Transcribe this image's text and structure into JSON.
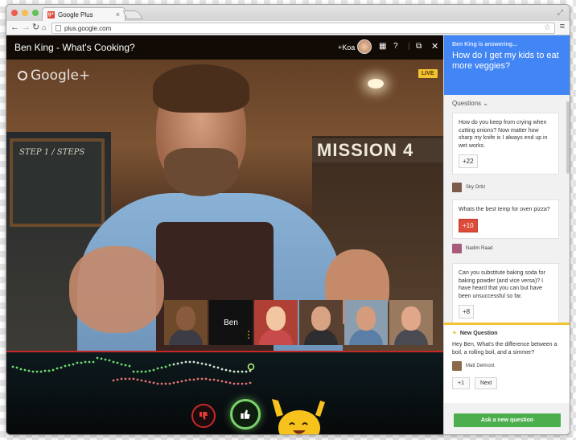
{
  "browser": {
    "tab_title": "Google Plus",
    "favicon_text": "g+",
    "url": "plus.google.com",
    "traffic_lights": [
      "#ee5c54",
      "#f5be4f",
      "#5fc453"
    ]
  },
  "hangout": {
    "title": "Ben King - What's Cooking?",
    "invite_label": "+Koa",
    "logo_text": "Google+",
    "live_badge": "LIVE",
    "sign_text": "MISSION 4",
    "chalkboard_text": "STEP 1 / STEPS",
    "participants": [
      {
        "face": "#8a5a3c",
        "body": "#3c3c46",
        "bg": "#6e4a2a",
        "label": ""
      },
      {
        "face": "",
        "body": "",
        "bg": "#111111",
        "label": "Ben"
      },
      {
        "face": "#f3c6a2",
        "body": "#c94a4a",
        "bg": "#b04036",
        "label": ""
      },
      {
        "face": "#d8a382",
        "body": "#2e2e30",
        "bg": "#5a4030",
        "label": ""
      },
      {
        "face": "#d49c7c",
        "body": "#5b7ea6",
        "bg": "#8a9eb0",
        "label": ""
      },
      {
        "face": "#e0a78a",
        "body": "#4a4a52",
        "bg": "#9a7a5e",
        "label": ""
      }
    ]
  },
  "side_panel": {
    "answering_label": "Ben King is answering...",
    "current_question": "How do I get my kids to eat more veggies?",
    "questions_toggle": "Questions",
    "questions": [
      {
        "text": "How do you keep from crying when cutting onions? Now matter how sharp my knife is I always end up in wet works.",
        "votes": "+22",
        "hot": false,
        "author": "Sky Ortiz"
      },
      {
        "text": "Whats the best temp for oven pizza?",
        "votes": "+10",
        "hot": true,
        "author": "Nadim Raad"
      },
      {
        "text": "Can you substitute baking soda for baking powder (and vice versa)? I have heard that you can but have been unsuccessful so far.",
        "votes": "+8",
        "hot": false,
        "author": ""
      }
    ],
    "new_question": {
      "heading": "New Question",
      "text": "Hey Ben, What's the difference between a boil, a rolling boil, and a simmer?",
      "author": "Matt Delmont",
      "plus_one": "+1",
      "next": "Next"
    },
    "ask_button": "Ask a new question"
  }
}
